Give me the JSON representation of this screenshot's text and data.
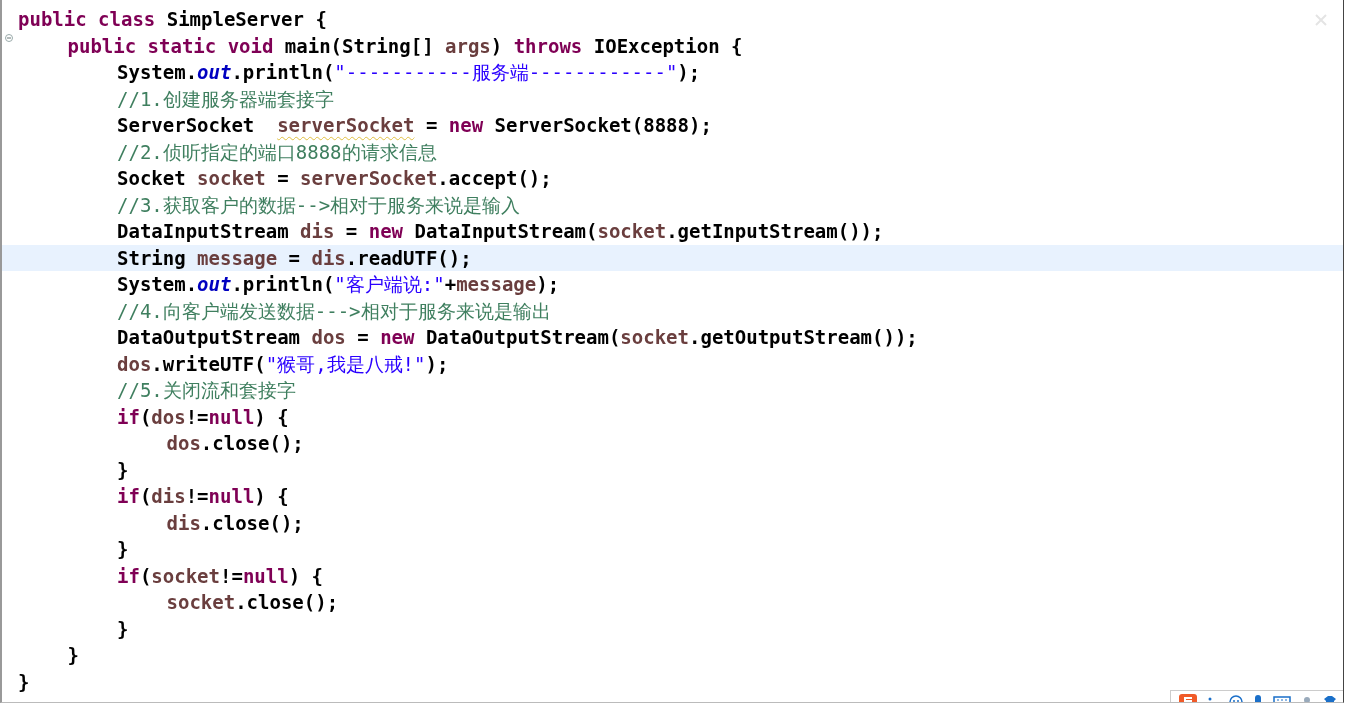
{
  "editor": {
    "lines": [
      {
        "current": false,
        "tokens": [
          {
            "kind": "keyword",
            "text": "public"
          },
          {
            "kind": "keyword",
            "text": " class"
          },
          {
            "kind": "plain",
            "text": " SimpleServer {"
          }
        ],
        "children": [
          {
            "current": false,
            "fold_marker": true,
            "tokens": [
              {
                "kind": "keyword",
                "text": "public"
              },
              {
                "kind": "keyword",
                "text": " static"
              },
              {
                "kind": "keyword",
                "text": " void"
              },
              {
                "kind": "plain",
                "text": " main(String[] "
              },
              {
                "kind": "local",
                "text": "args"
              },
              {
                "kind": "plain",
                "text": ") "
              },
              {
                "kind": "keyword",
                "text": "throws"
              },
              {
                "kind": "plain",
                "text": " IOException {"
              }
            ],
            "children": [
              {
                "current": false,
                "tokens": [
                  {
                    "kind": "plain",
                    "text": "System."
                  },
                  {
                    "kind": "field",
                    "text": "out"
                  },
                  {
                    "kind": "plain",
                    "text": ".println("
                  },
                  {
                    "kind": "string",
                    "text": "\"-----------服务端------------\""
                  },
                  {
                    "kind": "plain",
                    "text": ");"
                  }
                ]
              },
              {
                "current": false,
                "tokens": [
                  {
                    "kind": "comment",
                    "text": "//1.创建服务器端套接字"
                  }
                ]
              },
              {
                "current": false,
                "tokens": [
                  {
                    "kind": "plain",
                    "text": "ServerSocket  "
                  },
                  {
                    "kind": "local",
                    "text": "serverSocket",
                    "warning": true
                  },
                  {
                    "kind": "plain",
                    "text": " = "
                  },
                  {
                    "kind": "keyword",
                    "text": "new"
                  },
                  {
                    "kind": "plain",
                    "text": " ServerSocket(8888);"
                  }
                ]
              },
              {
                "current": false,
                "tokens": [
                  {
                    "kind": "comment",
                    "text": "//2.侦听指定的端口8888的请求信息"
                  }
                ]
              },
              {
                "current": false,
                "tokens": [
                  {
                    "kind": "plain",
                    "text": "Socket "
                  },
                  {
                    "kind": "local",
                    "text": "socket"
                  },
                  {
                    "kind": "plain",
                    "text": " = "
                  },
                  {
                    "kind": "local",
                    "text": "serverSocket"
                  },
                  {
                    "kind": "plain",
                    "text": ".accept();"
                  }
                ]
              },
              {
                "current": false,
                "tokens": [
                  {
                    "kind": "comment",
                    "text": "//3.获取客户的数据-->相对于服务来说是输入"
                  }
                ]
              },
              {
                "current": false,
                "tokens": [
                  {
                    "kind": "plain",
                    "text": "DataInputStream "
                  },
                  {
                    "kind": "local",
                    "text": "dis"
                  },
                  {
                    "kind": "plain",
                    "text": " = "
                  },
                  {
                    "kind": "keyword",
                    "text": "new"
                  },
                  {
                    "kind": "plain",
                    "text": " DataInputStream("
                  },
                  {
                    "kind": "local",
                    "text": "socket"
                  },
                  {
                    "kind": "plain",
                    "text": ".getInputStream());"
                  }
                ]
              },
              {
                "current": true,
                "tokens": [
                  {
                    "kind": "plain",
                    "text": "String "
                  },
                  {
                    "kind": "local",
                    "text": "message"
                  },
                  {
                    "kind": "plain",
                    "text": " = "
                  },
                  {
                    "kind": "local",
                    "text": "dis"
                  },
                  {
                    "kind": "plain",
                    "text": ".readUTF();"
                  }
                ]
              },
              {
                "current": false,
                "tokens": [
                  {
                    "kind": "plain",
                    "text": "System."
                  },
                  {
                    "kind": "field",
                    "text": "out"
                  },
                  {
                    "kind": "plain",
                    "text": ".println("
                  },
                  {
                    "kind": "string",
                    "text": "\"客户端说:\""
                  },
                  {
                    "kind": "plain",
                    "text": "+"
                  },
                  {
                    "kind": "local",
                    "text": "message"
                  },
                  {
                    "kind": "plain",
                    "text": ");"
                  }
                ]
              },
              {
                "current": false,
                "tokens": [
                  {
                    "kind": "comment",
                    "text": "//4.向客户端发送数据--->相对于服务来说是输出"
                  }
                ]
              },
              {
                "current": false,
                "tokens": [
                  {
                    "kind": "plain",
                    "text": "DataOutputStream "
                  },
                  {
                    "kind": "local",
                    "text": "dos"
                  },
                  {
                    "kind": "plain",
                    "text": " = "
                  },
                  {
                    "kind": "keyword",
                    "text": "new"
                  },
                  {
                    "kind": "plain",
                    "text": " DataOutputStream("
                  },
                  {
                    "kind": "local",
                    "text": "socket"
                  },
                  {
                    "kind": "plain",
                    "text": ".getOutputStream());"
                  }
                ]
              },
              {
                "current": false,
                "tokens": [
                  {
                    "kind": "local",
                    "text": "dos"
                  },
                  {
                    "kind": "plain",
                    "text": ".writeUTF("
                  },
                  {
                    "kind": "string",
                    "text": "\"猴哥,我是八戒!\""
                  },
                  {
                    "kind": "plain",
                    "text": ");"
                  }
                ]
              },
              {
                "current": false,
                "tokens": [
                  {
                    "kind": "comment",
                    "text": "//5.关闭流和套接字"
                  }
                ]
              },
              {
                "current": false,
                "tokens": [
                  {
                    "kind": "keyword",
                    "text": "if"
                  },
                  {
                    "kind": "plain",
                    "text": "("
                  },
                  {
                    "kind": "local",
                    "text": "dos"
                  },
                  {
                    "kind": "plain",
                    "text": "!="
                  },
                  {
                    "kind": "keyword",
                    "text": "null"
                  },
                  {
                    "kind": "plain",
                    "text": ") {"
                  }
                ],
                "children": [
                  {
                    "current": false,
                    "tokens": [
                      {
                        "kind": "local",
                        "text": "dos"
                      },
                      {
                        "kind": "plain",
                        "text": ".close();"
                      }
                    ]
                  }
                ]
              },
              {
                "current": false,
                "tokens": [
                  {
                    "kind": "plain",
                    "text": "}"
                  }
                ]
              },
              {
                "current": false,
                "tokens": [
                  {
                    "kind": "keyword",
                    "text": "if"
                  },
                  {
                    "kind": "plain",
                    "text": "("
                  },
                  {
                    "kind": "local",
                    "text": "dis"
                  },
                  {
                    "kind": "plain",
                    "text": "!="
                  },
                  {
                    "kind": "keyword",
                    "text": "null"
                  },
                  {
                    "kind": "plain",
                    "text": ") {"
                  }
                ],
                "children": [
                  {
                    "current": false,
                    "tokens": [
                      {
                        "kind": "local",
                        "text": "dis"
                      },
                      {
                        "kind": "plain",
                        "text": ".close();"
                      }
                    ]
                  }
                ]
              },
              {
                "current": false,
                "tokens": [
                  {
                    "kind": "plain",
                    "text": "}"
                  }
                ]
              },
              {
                "current": false,
                "tokens": [
                  {
                    "kind": "keyword",
                    "text": "if"
                  },
                  {
                    "kind": "plain",
                    "text": "("
                  },
                  {
                    "kind": "local",
                    "text": "socket"
                  },
                  {
                    "kind": "plain",
                    "text": "!="
                  },
                  {
                    "kind": "keyword",
                    "text": "null"
                  },
                  {
                    "kind": "plain",
                    "text": ") {"
                  }
                ],
                "children": [
                  {
                    "current": false,
                    "tokens": [
                      {
                        "kind": "local",
                        "text": "socket"
                      },
                      {
                        "kind": "plain",
                        "text": ".close();"
                      }
                    ]
                  }
                ]
              },
              {
                "current": false,
                "tokens": [
                  {
                    "kind": "plain",
                    "text": "}"
                  }
                ]
              }
            ]
          },
          {
            "current": false,
            "tokens": [
              {
                "kind": "plain",
                "text": "}"
              }
            ]
          }
        ]
      },
      {
        "current": false,
        "tokens": [
          {
            "kind": "plain",
            "text": "}"
          }
        ]
      }
    ]
  }
}
